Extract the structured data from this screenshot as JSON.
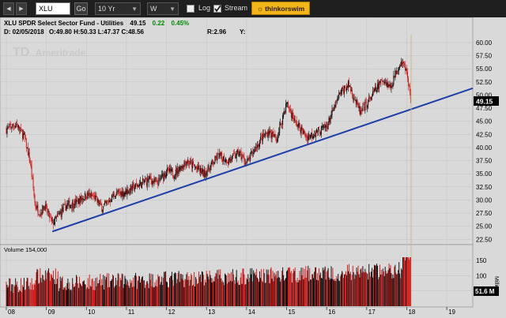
{
  "toolbar": {
    "symbol": "XLU",
    "go_label": "Go",
    "period": "10 Yr",
    "interval": "W",
    "log_label": "Log",
    "log_checked": false,
    "stream_label": "Stream",
    "stream_checked": true,
    "thinkorswim_label": "thinkorswim"
  },
  "header": {
    "title": "XLU SPDR Select Sector Fund - Utilities",
    "price": "49.15",
    "change": "0.22",
    "change_pct": "0.45%",
    "date": "D: 02/05/2018",
    "ohlc": "O:49.80 H:50.33 L:47.37 C:48.56",
    "r": "R:2.96",
    "y": "Y:"
  },
  "watermark": "Ameritrade",
  "price_axis": [
    "60.00",
    "57.50",
    "55.00",
    "52.50",
    "50.00",
    "47.50",
    "45.00",
    "42.50",
    "40.00",
    "37.50",
    "35.00",
    "32.50",
    "30.00",
    "27.50",
    "25.00",
    "22.50"
  ],
  "price_tag": "49.15",
  "volume": {
    "label": "Volume 154,000",
    "axis": [
      "150",
      "100",
      "50"
    ],
    "unit": "Millions",
    "tag": "51.6 M"
  },
  "x_axis": [
    "08",
    "09",
    "10",
    "11",
    "12",
    "13",
    "14",
    "15",
    "16",
    "17",
    "18",
    "19"
  ],
  "colors": {
    "up": "#000000",
    "down": "#cc1010",
    "trendline": "#1f3fa8",
    "panel_bg": "#d9d9d9",
    "cursor": "#c9b98a",
    "tag_bg": "#000000"
  },
  "chart_data": {
    "type": "candlestick",
    "price_keypoints": [
      [
        2008.0,
        43.5
      ],
      [
        2008.25,
        44.5
      ],
      [
        2008.45,
        42
      ],
      [
        2008.6,
        37
      ],
      [
        2008.72,
        29
      ],
      [
        2008.85,
        27.5
      ],
      [
        2008.95,
        29
      ],
      [
        2009.15,
        25.5
      ],
      [
        2009.3,
        27
      ],
      [
        2009.5,
        29
      ],
      [
        2009.75,
        29.5
      ],
      [
        2010.0,
        31
      ],
      [
        2010.2,
        30.5
      ],
      [
        2010.4,
        28.5
      ],
      [
        2010.7,
        31
      ],
      [
        2010.95,
        31.5
      ],
      [
        2011.2,
        32.5
      ],
      [
        2011.6,
        34
      ],
      [
        2011.75,
        33
      ],
      [
        2012.0,
        35.5
      ],
      [
        2012.2,
        35
      ],
      [
        2012.5,
        37.5
      ],
      [
        2012.75,
        36
      ],
      [
        2012.95,
        35
      ],
      [
        2013.3,
        38.5
      ],
      [
        2013.55,
        37.5
      ],
      [
        2013.8,
        39
      ],
      [
        2014.0,
        37
      ],
      [
        2014.35,
        41.5
      ],
      [
        2014.55,
        43
      ],
      [
        2014.75,
        41.5
      ],
      [
        2015.0,
        48.5
      ],
      [
        2015.2,
        45
      ],
      [
        2015.5,
        42
      ],
      [
        2015.75,
        43
      ],
      [
        2016.0,
        44
      ],
      [
        2016.35,
        50.5
      ],
      [
        2016.55,
        52
      ],
      [
        2016.85,
        46.5
      ],
      [
        2017.1,
        49.5
      ],
      [
        2017.4,
        53
      ],
      [
        2017.6,
        51.5
      ],
      [
        2017.75,
        55
      ],
      [
        2017.88,
        56.5
      ],
      [
        2018.0,
        54.5
      ],
      [
        2018.1,
        49.2
      ]
    ],
    "trendline": [
      [
        2009.15,
        24.0
      ],
      [
        2019.65,
        51.3
      ]
    ],
    "volume_unit": "Millions",
    "volume_range": [
      0,
      160
    ],
    "y_range": [
      21.5,
      61.5
    ],
    "x_range": [
      2008.0,
      2019.65
    ],
    "last_price": 49.15,
    "last_volume": "51.6 M"
  }
}
